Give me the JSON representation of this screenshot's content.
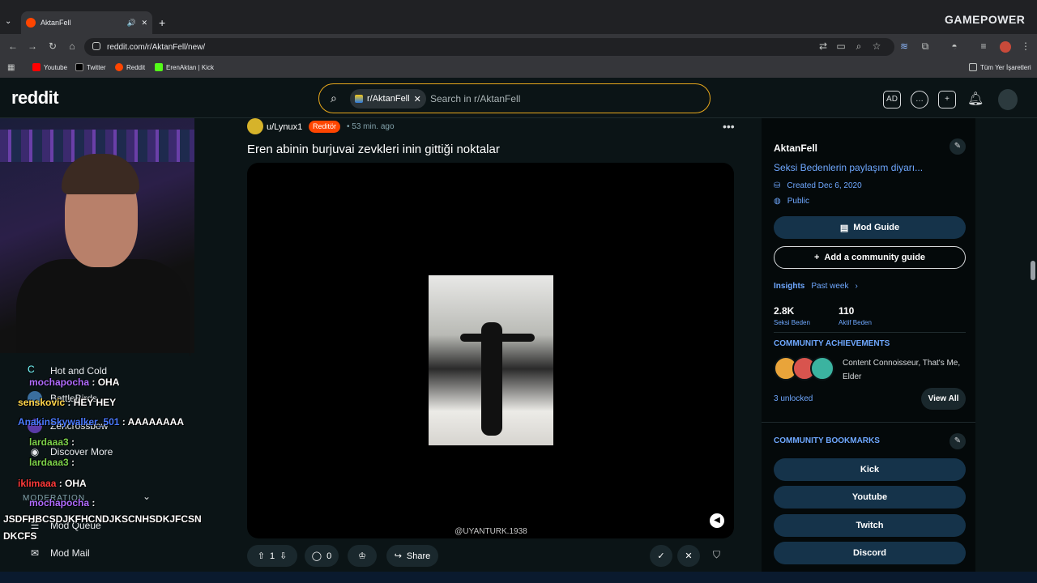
{
  "browser": {
    "tab_title": "AktanFell",
    "url": "reddit.com/r/AktanFell/new/",
    "bookmarks": [
      "Youtube",
      "Twitter",
      "Reddit",
      "ErenAktan | Kick"
    ],
    "all_bookmarks": "Tüm Yer İşaretleri",
    "brand_overlay": "GAMEPOWER"
  },
  "header": {
    "logo": "reddit",
    "search_chip": "r/AktanFell",
    "search_placeholder": "Search in r/AktanFell"
  },
  "sidebar": {
    "items": [
      {
        "label": "Hot and Cold"
      },
      {
        "label": "BattleBirds"
      },
      {
        "label": "Zencrossbow"
      },
      {
        "label": "Discover More"
      },
      {
        "label": "MODERATION"
      },
      {
        "label": "Mod Queue"
      },
      {
        "label": "Mod Mail"
      }
    ]
  },
  "chat": [
    {
      "user": "mochapocha",
      "msg": ": OHA",
      "color": "#b06cff"
    },
    {
      "user": "senskovic",
      "msg": ": HEY HEY",
      "color": "#ffd54a"
    },
    {
      "user": "AnakinSkywalker_501",
      "msg": ": AAAAAAAA",
      "color": "#4a7bff"
    },
    {
      "user": "lardaaa3",
      "msg": ":",
      "color": "#7bd14a"
    },
    {
      "user": "lardaaa3",
      "msg": ":",
      "color": "#7bd14a"
    },
    {
      "user": "iklimaaa",
      "msg": ": OHA",
      "color": "#ff3b3b"
    },
    {
      "user": "mochapocha",
      "msg": ":",
      "color": "#b06cff"
    },
    {
      "user": "",
      "msg": "JSDFHBCSDJKFHCNDJKSCNHSDKJFCSN",
      "color": "#fff"
    },
    {
      "user": "",
      "msg": "DKCFS",
      "color": "#fff"
    }
  ],
  "post": {
    "username": "u/Lynux1",
    "flair": "Reditör",
    "time": "• 53 min. ago",
    "title": "Eren abinin burjuvai zevkleri inin gittiği noktalar",
    "watermark": "@UYANTURK.1938",
    "votes": "1",
    "comments": "0",
    "share": "Share"
  },
  "community": {
    "name": "AktanFell",
    "description": "Seksi Bedenlerin paylaşım diyarı...",
    "created": "Created Dec 6, 2020",
    "visibility": "Public",
    "mod_guide": "Mod Guide",
    "add_guide": "Add a community guide",
    "insights": "Insights",
    "period": "Past week",
    "stat1_value": "2.8K",
    "stat1_label": "Seksi Beden",
    "stat2_value": "110",
    "stat2_label": "Aktif Beden",
    "achievements_title": "COMMUNITY ACHIEVEMENTS",
    "achievements_text": "Content Connoisseur, That's Me, Elder",
    "unlocked": "3 unlocked",
    "view_all": "View All",
    "bookmarks_title": "COMMUNITY BOOKMARKS",
    "bookmarks": [
      "Kick",
      "Youtube",
      "Twitch",
      "Discord"
    ]
  },
  "colors": {
    "accent_orange": "#ff4500",
    "link_blue": "#6fa8ff",
    "search_border": "#e8a81c"
  }
}
